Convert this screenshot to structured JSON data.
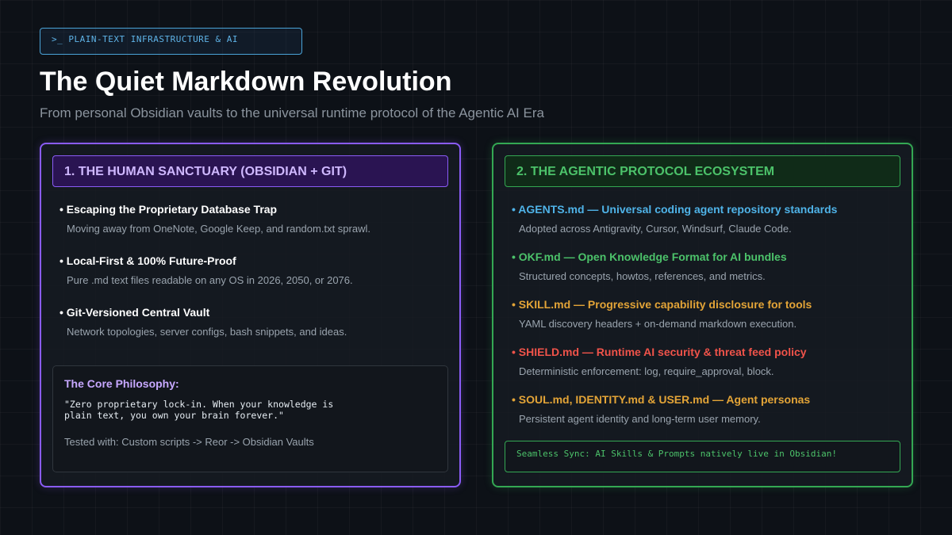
{
  "header": {
    "tag": ">_ PLAIN-TEXT INFRASTRUCTURE & AI",
    "title": "The Quiet Markdown Revolution",
    "subtitle": "From personal Obsidian vaults to the universal runtime protocol of the Agentic AI Era"
  },
  "left": {
    "heading": "1. THE HUMAN SANCTUARY (OBSIDIAN + GIT)",
    "items": [
      {
        "title": "• Escaping the Proprietary Database Trap",
        "desc": "Moving away from OneNote, Google Keep, and random.txt sprawl."
      },
      {
        "title": "• Local-First & 100% Future-Proof",
        "desc": "Pure .md text files readable on any OS in 2026, 2050, or 2076."
      },
      {
        "title": "• Git-Versioned Central Vault",
        "desc": "Network topologies, server configs, bash snippets, and ideas."
      }
    ],
    "philosophy": {
      "title": "The Core Philosophy:",
      "quote": "\"Zero proprietary lock-in. When your knowledge is\nplain text, you own your brain forever.\"",
      "tested": "Tested with: Custom scripts -> Reor -> Obsidian Vaults"
    }
  },
  "right": {
    "heading": "2. THE AGENTIC PROTOCOL ECOSYSTEM",
    "items": [
      {
        "title": "• AGENTS.md — Universal coding agent repository standards",
        "desc": "Adopted across Antigravity, Cursor, Windsurf, Claude Code.",
        "color": "#4fb3e8"
      },
      {
        "title": "• OKF.md — Open Knowledge Format for AI bundles",
        "desc": "Structured concepts, howtos, references, and metrics.",
        "color": "#4cc26a"
      },
      {
        "title": "• SKILL.md — Progressive capability disclosure for tools",
        "desc": "YAML discovery headers + on-demand markdown execution.",
        "color": "#e3a437"
      },
      {
        "title": "• SHIELD.md — Runtime AI security & threat feed policy",
        "desc": "Deterministic enforcement: log, require_approval, block.",
        "color": "#f0534a"
      },
      {
        "title": "• SOUL.md, IDENTITY.md & USER.md — Agent personas",
        "desc": "Persistent agent identity and long-term user memory.",
        "color": "#e3a437"
      }
    ],
    "sync": "Seamless Sync: AI Skills & Prompts natively live in Obsidian!"
  }
}
